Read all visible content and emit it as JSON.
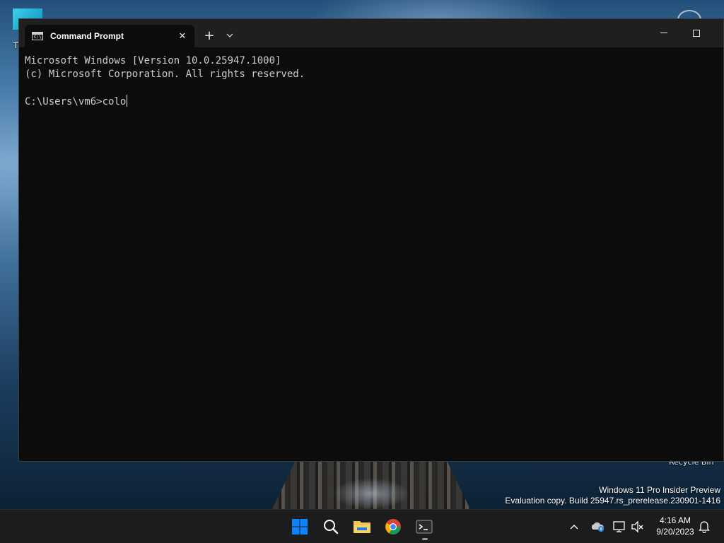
{
  "desktop": {
    "partial_icon_label": "T",
    "recycle_bin_label": "Recycle Bin",
    "watermark_line1": "Windows 11 Pro Insider Preview",
    "watermark_line2": "Evaluation copy. Build 25947.rs_prerelease.230901-1416"
  },
  "window": {
    "tab_title": "Command Prompt",
    "tab_icon_text": "C:\\.",
    "close_tab_glyph": "✕",
    "new_tab_glyph": "+",
    "console_lines": [
      "Microsoft Windows [Version 10.0.25947.1000]",
      "(c) Microsoft Corporation. All rights reserved.",
      "",
      "C:\\Users\\vm6>colo"
    ]
  },
  "taskbar": {
    "time": "4:16 AM",
    "date": "9/20/2023",
    "icons": [
      "start-icon",
      "search-icon",
      "file-explorer-icon",
      "chrome-icon",
      "terminal-icon"
    ],
    "tray_icons": [
      "chevron-up-icon",
      "onedrive-icon",
      "network-icon",
      "volume-muted-icon",
      "bell-icon"
    ]
  },
  "colors": {
    "console_bg": "#0c0c0c",
    "titlebar_bg": "#1f1f1f",
    "console_text": "#cccccc",
    "taskbar_bg": "#1c1c1c",
    "start_blue": "#0a84ff",
    "folder_yellow": "#f2c54b"
  }
}
